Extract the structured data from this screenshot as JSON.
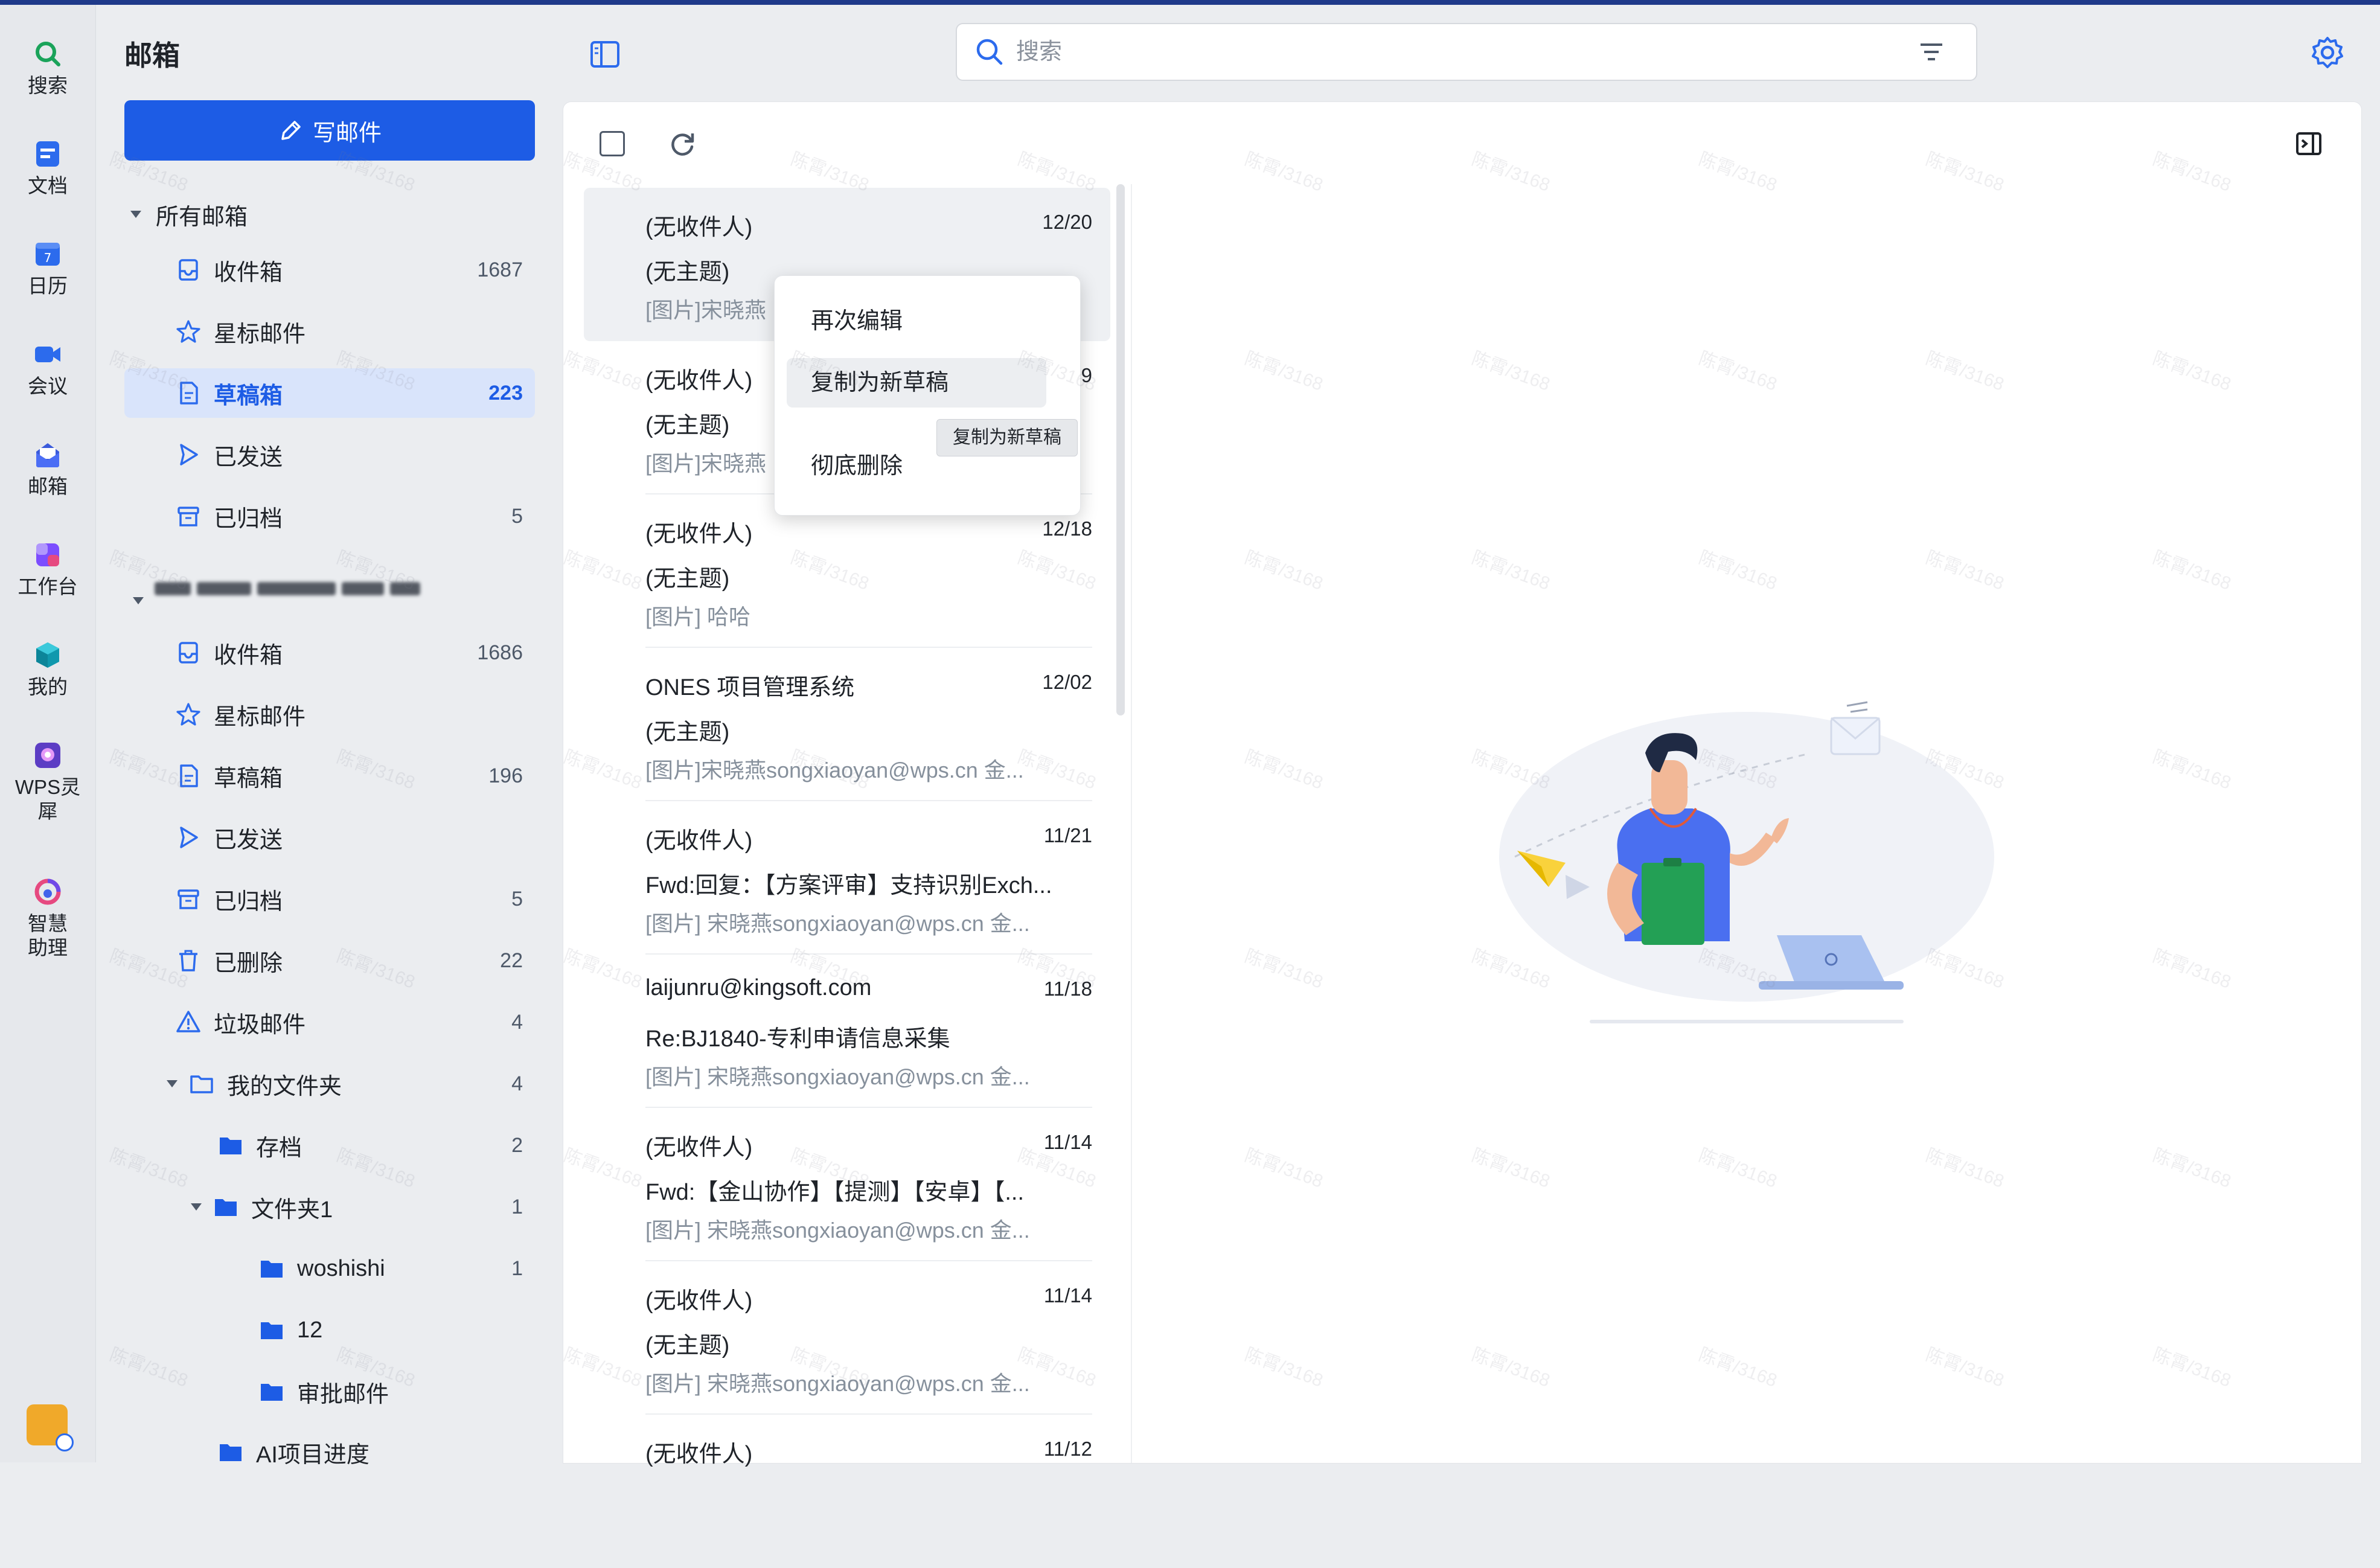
{
  "rail": {
    "items": [
      {
        "label": "搜索",
        "icon": "search-icon"
      },
      {
        "label": "文档",
        "icon": "document-icon"
      },
      {
        "label": "日历",
        "icon": "calendar-icon"
      },
      {
        "label": "会议",
        "icon": "video-meeting-icon"
      },
      {
        "label": "邮箱",
        "icon": "mail-icon"
      },
      {
        "label": "工作台",
        "icon": "workbench-icon"
      },
      {
        "label": "我的",
        "icon": "cube-icon"
      },
      {
        "label": "WPS灵犀",
        "icon": "wps-lingxi-icon"
      },
      {
        "label": "智慧助理",
        "icon": "assistant-icon"
      }
    ]
  },
  "sidebar": {
    "title": "邮箱",
    "compose_label": "写邮件",
    "all_mailboxes_label": "所有邮箱",
    "all_items": [
      {
        "label": "收件箱",
        "count": "1687",
        "icon": "inbox-icon"
      },
      {
        "label": "星标邮件",
        "count": "",
        "icon": "star-icon"
      },
      {
        "label": "草稿箱",
        "count": "223",
        "icon": "draft-icon",
        "active": true
      },
      {
        "label": "已发送",
        "count": "",
        "icon": "sent-icon"
      },
      {
        "label": "已归档",
        "count": "5",
        "icon": "archive-icon"
      }
    ],
    "account_items": [
      {
        "label": "收件箱",
        "count": "1686",
        "icon": "inbox-icon"
      },
      {
        "label": "星标邮件",
        "count": "",
        "icon": "star-icon"
      },
      {
        "label": "草稿箱",
        "count": "196",
        "icon": "draft-icon"
      },
      {
        "label": "已发送",
        "count": "",
        "icon": "sent-icon"
      },
      {
        "label": "已归档",
        "count": "5",
        "icon": "archive-icon"
      },
      {
        "label": "已删除",
        "count": "22",
        "icon": "trash-icon"
      },
      {
        "label": "垃圾邮件",
        "count": "4",
        "icon": "spam-warning-icon"
      }
    ],
    "my_folders": {
      "label": "我的文件夹",
      "count": "4"
    },
    "folders": [
      {
        "label": "存档",
        "count": "2"
      },
      {
        "label": "文件夹1",
        "count": "1"
      },
      {
        "label": "woshishi",
        "count": "1"
      },
      {
        "label": "12",
        "count": ""
      },
      {
        "label": "审批邮件",
        "count": ""
      },
      {
        "label": "AI项目进度",
        "count": ""
      }
    ]
  },
  "search": {
    "placeholder": "搜索"
  },
  "mail_list": [
    {
      "from": "(无收件人)",
      "date": "12/20",
      "subject": "(无主题)",
      "preview": "[图片]宋晓燕",
      "selected": true
    },
    {
      "from": "(无收件人)",
      "date": "9",
      "subject": "(无主题)",
      "preview": "[图片]宋晓燕"
    },
    {
      "from": "(无收件人)",
      "date": "12/18",
      "subject": "(无主题)",
      "preview": "[图片] 哈哈"
    },
    {
      "from": "ONES 项目管理系统",
      "date": "12/02",
      "subject": "(无主题)",
      "preview": "[图片]宋晓燕songxiaoyan@wps.cn 金..."
    },
    {
      "from": "(无收件人)",
      "date": "11/21",
      "subject": "Fwd:回复：【方案评审】支持识别Exch...",
      "preview": "[图片] 宋晓燕songxiaoyan@wps.cn 金..."
    },
    {
      "from": "laijunru@kingsoft.com",
      "date": "11/18",
      "subject": "Re:BJ1840-专利申请信息采集",
      "preview": "[图片] 宋晓燕songxiaoyan@wps.cn 金..."
    },
    {
      "from": "(无收件人)",
      "date": "11/14",
      "subject": "Fwd:【金山协作】【提测】【安卓】【...",
      "preview": "[图片] 宋晓燕songxiaoyan@wps.cn 金..."
    },
    {
      "from": "(无收件人)",
      "date": "11/14",
      "subject": "(无主题)",
      "preview": "[图片] 宋晓燕songxiaoyan@wps.cn 金..."
    },
    {
      "from": "(无收件人)",
      "date": "11/12",
      "subject": "",
      "preview": ""
    }
  ],
  "context_menu": {
    "items": [
      "再次编辑",
      "复制为新草稿",
      "彻底删除"
    ],
    "tooltip": "复制为新草稿"
  },
  "watermark": "陈霄/3168",
  "colors": {
    "accent": "#1d5ce5",
    "active_bg": "#d9e4fb",
    "rail_bg": "#e6e8ec"
  }
}
